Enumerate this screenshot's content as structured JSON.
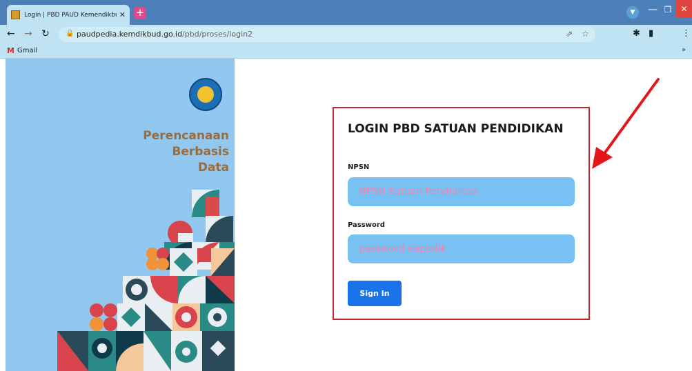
{
  "browser": {
    "tab_title": "Login | PBD PAUD Kemendikbud",
    "tab_close": "✕",
    "new_tab": "+",
    "url_domain": "paudpedia.kemdikbud.go.id",
    "url_path": "/pbd/proses/login2",
    "bookmark_gmail": "Gmail",
    "bookmark_gmail_mark": "M",
    "bookmarks_more": "»"
  },
  "brand": {
    "line1": "Perencanaan",
    "line2": "Berbasis",
    "line3": "Data"
  },
  "login": {
    "title": "LOGIN PBD SATUAN PENDIDIKAN",
    "npsn_label": "NPSN",
    "npsn_placeholder": "NPSN Satuan Pendidikan",
    "password_label": "Password",
    "password_placeholder": "password dapodik",
    "signin_label": "Sign In"
  },
  "colors": {
    "accent": "#1a73e8",
    "panel": "#92c7ef",
    "input_bg": "#77c1f3",
    "box_border": "#c4232a",
    "arrow": "#e3171b"
  },
  "icons": [
    "back-icon",
    "forward-icon",
    "reload-icon",
    "lock-icon",
    "share-icon",
    "star-icon",
    "extensions-icon",
    "sidepanel-icon",
    "menu-icon"
  ]
}
